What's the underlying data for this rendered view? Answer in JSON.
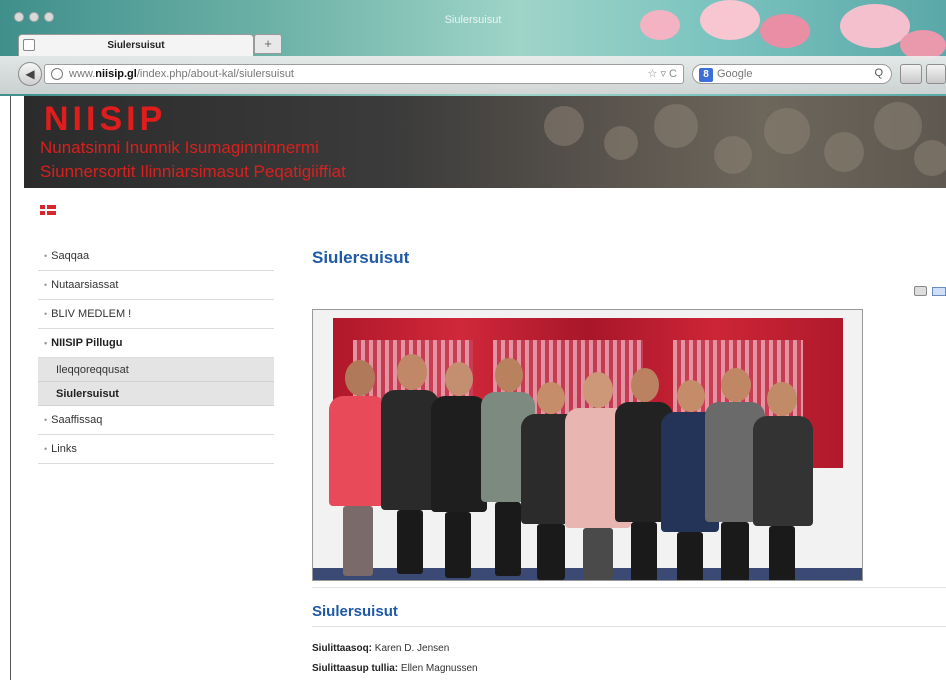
{
  "browser": {
    "window_title": "Siulersuisut",
    "tab_title": "Siulersuisut",
    "new_tab_label": "+",
    "url_prefix": "www.",
    "url_domain": "niisip.gl",
    "url_path": "/index.php/about-kal/siulersuisut",
    "search_placeholder": "Google",
    "search_engine_letter": "8"
  },
  "site": {
    "brand": "NIISIP",
    "subtitle_line1": "Nunatsinni Inunnik Isumaginninnermi",
    "subtitle_line2": "Siunnersortit Ilinniarsimasut Peqatigiiffiat",
    "brand_color": "#e01d1d"
  },
  "menu": {
    "items": [
      {
        "label": "Saqqaa"
      },
      {
        "label": "Nutaarsiassat"
      },
      {
        "label": "BLIV MEDLEM !"
      },
      {
        "label": "NIISIP Pillugu"
      }
    ],
    "submenu": [
      {
        "label": "Ileqqoreqqusat"
      },
      {
        "label": "Siulersuisut"
      }
    ],
    "items_after": [
      {
        "label": "Saaffissaq"
      },
      {
        "label": "Links"
      }
    ]
  },
  "content": {
    "page_heading": "Siulersuisut",
    "section_heading": "Siulersuisut",
    "info": [
      {
        "key": "Siulittaasoq:",
        "value": "Karen D. Jensen"
      },
      {
        "key": "Siulittaasup tullia:",
        "value": "Ellen Magnussen"
      }
    ],
    "heading_color": "#1f5aa6"
  },
  "icons": {
    "print": "printer-icon",
    "email": "email-icon",
    "language": "danish-flag-icon"
  }
}
